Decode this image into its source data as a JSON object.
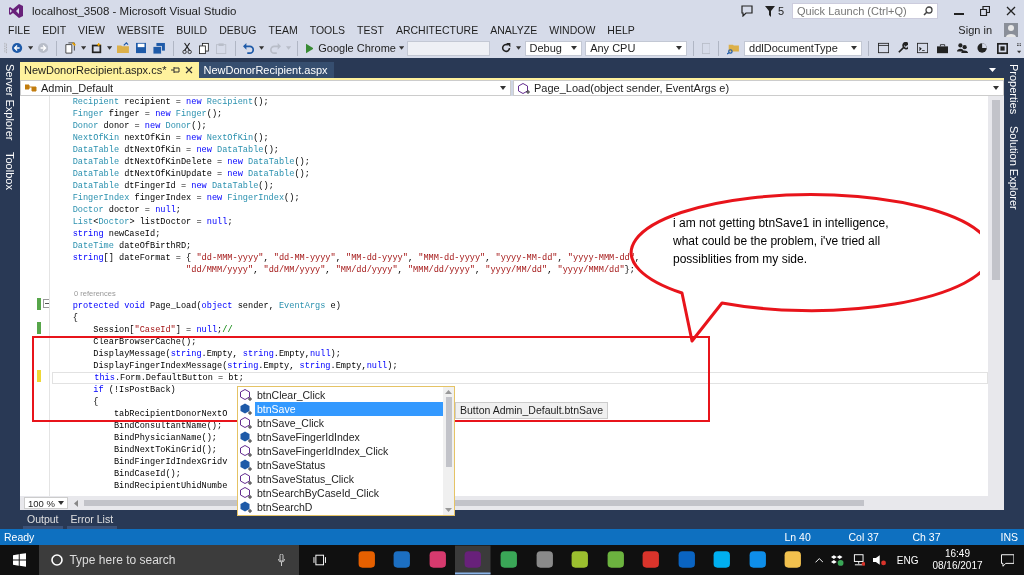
{
  "window": {
    "title": "localhost_3508 - Microsoft Visual Studio",
    "notification_count": "5",
    "quick_launch": {
      "placeholder": "Quick Launch (Ctrl+Q)"
    }
  },
  "menu": [
    "FILE",
    "EDIT",
    "VIEW",
    "WEBSITE",
    "BUILD",
    "DEBUG",
    "TEAM",
    "TOOLS",
    "TEST",
    "ARCHITECTURE",
    "ANALYZE",
    "WINDOW",
    "HELP"
  ],
  "account": {
    "label": "Sign in"
  },
  "toolbar": {
    "start_target": "Google Chrome",
    "configuration": "Debug",
    "platform": "Any CPU",
    "control": "ddlDocumentType"
  },
  "left_panels": [
    "Server Explorer",
    "Toolbox"
  ],
  "right_panels": [
    "Properties",
    "Solution Explorer"
  ],
  "tabs": [
    {
      "label": "NewDonorRecipient.aspx.cs*",
      "selected": true
    },
    {
      "label": "NewDonorRecipient.aspx",
      "selected": false
    }
  ],
  "navigation": {
    "type": "Admin_Default",
    "member": "Page_Load(object sender, EventArgs e)"
  },
  "code": {
    "lines": [
      {
        "kind": "code",
        "tokens": [
          {
            "text": "    Recipient",
            "kind": "type"
          },
          {
            "text": " recipient = ",
            "kind": "plain"
          },
          {
            "text": "new",
            "kind": "kw"
          },
          {
            "text": " Recipient",
            "kind": "type"
          },
          {
            "text": "();",
            "kind": "plain"
          }
        ]
      },
      {
        "kind": "code",
        "tokens": [
          {
            "text": "    Finger",
            "kind": "type"
          },
          {
            "text": " finger = ",
            "kind": "plain"
          },
          {
            "text": "new",
            "kind": "kw"
          },
          {
            "text": " Finger",
            "kind": "type"
          },
          {
            "text": "();",
            "kind": "plain"
          }
        ]
      },
      {
        "kind": "code",
        "tokens": [
          {
            "text": "    Donor",
            "kind": "type"
          },
          {
            "text": " donor = ",
            "kind": "plain"
          },
          {
            "text": "new",
            "kind": "kw"
          },
          {
            "text": " Donor",
            "kind": "type"
          },
          {
            "text": "();",
            "kind": "plain"
          }
        ]
      },
      {
        "kind": "code",
        "tokens": [
          {
            "text": "    NextOfKin",
            "kind": "type"
          },
          {
            "text": " nextOfKin = ",
            "kind": "plain"
          },
          {
            "text": "new",
            "kind": "kw"
          },
          {
            "text": " NextOfKin",
            "kind": "type"
          },
          {
            "text": "();",
            "kind": "plain"
          }
        ]
      },
      {
        "kind": "code",
        "tokens": [
          {
            "text": "    DataTable",
            "kind": "type"
          },
          {
            "text": " dtNextOfKin = ",
            "kind": "plain"
          },
          {
            "text": "new",
            "kind": "kw"
          },
          {
            "text": " DataTable",
            "kind": "type"
          },
          {
            "text": "();",
            "kind": "plain"
          }
        ]
      },
      {
        "kind": "code",
        "tokens": [
          {
            "text": "    DataTable",
            "kind": "type"
          },
          {
            "text": " dtNextOfKinDelete = ",
            "kind": "plain"
          },
          {
            "text": "new",
            "kind": "kw"
          },
          {
            "text": " DataTable",
            "kind": "type"
          },
          {
            "text": "();",
            "kind": "plain"
          }
        ]
      },
      {
        "kind": "code",
        "tokens": [
          {
            "text": "    DataTable",
            "kind": "type"
          },
          {
            "text": " dtNextOfKinUpdate = ",
            "kind": "plain"
          },
          {
            "text": "new",
            "kind": "kw"
          },
          {
            "text": " DataTable",
            "kind": "type"
          },
          {
            "text": "();",
            "kind": "plain"
          }
        ]
      },
      {
        "kind": "code",
        "tokens": [
          {
            "text": "    DataTable",
            "kind": "type"
          },
          {
            "text": " dtFingerId = ",
            "kind": "plain"
          },
          {
            "text": "new",
            "kind": "kw"
          },
          {
            "text": " DataTable",
            "kind": "type"
          },
          {
            "text": "();",
            "kind": "plain"
          }
        ]
      },
      {
        "kind": "code",
        "tokens": [
          {
            "text": "    FingerIndex",
            "kind": "type"
          },
          {
            "text": " fingerIndex = ",
            "kind": "plain"
          },
          {
            "text": "new",
            "kind": "kw"
          },
          {
            "text": " FingerIndex",
            "kind": "type"
          },
          {
            "text": "();",
            "kind": "plain"
          }
        ]
      },
      {
        "kind": "code",
        "tokens": [
          {
            "text": "    Doctor",
            "kind": "type"
          },
          {
            "text": " doctor = ",
            "kind": "plain"
          },
          {
            "text": "null",
            "kind": "kw"
          },
          {
            "text": ";",
            "kind": "plain"
          }
        ]
      },
      {
        "kind": "code",
        "tokens": [
          {
            "text": "    List",
            "kind": "type"
          },
          {
            "text": "<",
            "kind": "plain"
          },
          {
            "text": "Doctor",
            "kind": "type"
          },
          {
            "text": "> listDoctor = ",
            "kind": "plain"
          },
          {
            "text": "null",
            "kind": "kw"
          },
          {
            "text": ";",
            "kind": "plain"
          }
        ]
      },
      {
        "kind": "code",
        "tokens": [
          {
            "text": "    string",
            "kind": "kw"
          },
          {
            "text": " newCaseId;",
            "kind": "plain"
          }
        ]
      },
      {
        "kind": "code",
        "tokens": [
          {
            "text": "    DateTime",
            "kind": "type"
          },
          {
            "text": " dateOfBirthRD;",
            "kind": "plain"
          }
        ]
      },
      {
        "kind": "code",
        "tokens": [
          {
            "text": "    string",
            "kind": "kw"
          },
          {
            "text": "[] dateFormat = { ",
            "kind": "plain"
          },
          {
            "text": "\"dd-MMM-yyyy\"",
            "kind": "str"
          },
          {
            "text": ", ",
            "kind": "plain"
          },
          {
            "text": "\"dd-MM-yyyy\"",
            "kind": "str"
          },
          {
            "text": ", ",
            "kind": "plain"
          },
          {
            "text": "\"MM-dd-yyyy\"",
            "kind": "str"
          },
          {
            "text": ", ",
            "kind": "plain"
          },
          {
            "text": "\"MMM-dd-yyyy\"",
            "kind": "str"
          },
          {
            "text": ", ",
            "kind": "plain"
          },
          {
            "text": "\"yyyy-MM-dd\"",
            "kind": "str"
          },
          {
            "text": ", ",
            "kind": "plain"
          },
          {
            "text": "\"yyyy-MMM-dd\"",
            "kind": "str"
          },
          {
            "text": ",",
            "kind": "plain"
          }
        ]
      },
      {
        "kind": "code",
        "tokens": [
          {
            "text": "                          \"dd/MMM/yyyy\"",
            "kind": "str"
          },
          {
            "text": ", ",
            "kind": "plain"
          },
          {
            "text": "\"dd/MM/yyyy\"",
            "kind": "str"
          },
          {
            "text": ", ",
            "kind": "plain"
          },
          {
            "text": "\"MM/dd/yyyy\"",
            "kind": "str"
          },
          {
            "text": ", ",
            "kind": "plain"
          },
          {
            "text": "\"MMM/dd/yyyy\"",
            "kind": "str"
          },
          {
            "text": ", ",
            "kind": "plain"
          },
          {
            "text": "\"yyyy/MM/dd\"",
            "kind": "str"
          },
          {
            "text": ", ",
            "kind": "plain"
          },
          {
            "text": "\"yyyy/MMM/dd\"",
            "kind": "str"
          },
          {
            "text": "};",
            "kind": "plain"
          }
        ]
      },
      {
        "kind": "blank"
      },
      {
        "kind": "lens",
        "text": "0 references"
      },
      {
        "kind": "code",
        "modified": true,
        "saved": true,
        "fold": true,
        "tokens": [
          {
            "text": "    protected",
            "kind": "kw"
          },
          {
            "text": " void",
            "kind": "kw"
          },
          {
            "text": " Page_Load(",
            "kind": "plain"
          },
          {
            "text": "object",
            "kind": "kw"
          },
          {
            "text": " sender, ",
            "kind": "plain"
          },
          {
            "text": "EventArgs",
            "kind": "type"
          },
          {
            "text": " e)",
            "kind": "plain"
          }
        ]
      },
      {
        "kind": "code",
        "tokens": [
          {
            "text": "    {",
            "kind": "plain"
          }
        ]
      },
      {
        "kind": "code",
        "modified": true,
        "saved": true,
        "tokens": [
          {
            "text": "        Session[",
            "kind": "plain"
          },
          {
            "text": "\"CaseId\"",
            "kind": "str"
          },
          {
            "text": "] = ",
            "kind": "plain"
          },
          {
            "text": "null",
            "kind": "kw"
          },
          {
            "text": ";",
            "kind": "plain"
          },
          {
            "text": "//",
            "kind": "comment"
          }
        ]
      },
      {
        "kind": "code",
        "tokens": [
          {
            "text": "        ClearBrowserCache();",
            "kind": "plain"
          }
        ]
      },
      {
        "kind": "code",
        "tokens": [
          {
            "text": "        DisplayMessage(",
            "kind": "plain"
          },
          {
            "text": "string",
            "kind": "kw"
          },
          {
            "text": ".Empty, ",
            "kind": "plain"
          },
          {
            "text": "string",
            "kind": "kw"
          },
          {
            "text": ".Empty,",
            "kind": "plain"
          },
          {
            "text": "null",
            "kind": "kw"
          },
          {
            "text": ");",
            "kind": "plain"
          }
        ]
      },
      {
        "kind": "code",
        "tokens": [
          {
            "text": "        DisplayFingerIndexMessage(",
            "kind": "plain"
          },
          {
            "text": "string",
            "kind": "kw"
          },
          {
            "text": ".Empty, ",
            "kind": "plain"
          },
          {
            "text": "string",
            "kind": "kw"
          },
          {
            "text": ".Empty,",
            "kind": "plain"
          },
          {
            "text": "null",
            "kind": "kw"
          },
          {
            "text": ");",
            "kind": "plain"
          }
        ]
      },
      {
        "kind": "code",
        "modified": true,
        "saved": false,
        "current": true,
        "tokens": [
          {
            "text": "        this",
            "kind": "kw"
          },
          {
            "text": ".Form.DefaultButton = bt;",
            "kind": "plain"
          }
        ]
      },
      {
        "kind": "code",
        "tokens": [
          {
            "text": "        if",
            "kind": "kw"
          },
          {
            "text": " (!IsPostBack)",
            "kind": "plain"
          }
        ]
      },
      {
        "kind": "code",
        "tokens": [
          {
            "text": "        {",
            "kind": "plain"
          }
        ]
      },
      {
        "kind": "code",
        "tokens": [
          {
            "text": "            tabRecipientDonorNextO",
            "kind": "plain"
          }
        ]
      },
      {
        "kind": "code",
        "tokens": [
          {
            "text": "            BindConsultantName();",
            "kind": "plain"
          }
        ]
      },
      {
        "kind": "code",
        "tokens": [
          {
            "text": "            BindPhysicianName();",
            "kind": "plain"
          }
        ]
      },
      {
        "kind": "code",
        "tokens": [
          {
            "text": "            BindNextToKinGrid();",
            "kind": "plain"
          }
        ]
      },
      {
        "kind": "code",
        "tokens": [
          {
            "text": "            BindFingerIdIndexGridv",
            "kind": "plain"
          }
        ]
      },
      {
        "kind": "code",
        "tokens": [
          {
            "text": "            BindCaseId();",
            "kind": "plain"
          }
        ]
      },
      {
        "kind": "code",
        "tokens": [
          {
            "text": "            BindRecipientUhidNumbe",
            "kind": "plain"
          }
        ]
      }
    ]
  },
  "completion": {
    "items": [
      {
        "label": "btnClear_Click",
        "kind": "method",
        "selected": false
      },
      {
        "label": "btnSave",
        "kind": "field",
        "selected": true
      },
      {
        "label": "btnSave_Click",
        "kind": "method",
        "selected": false
      },
      {
        "label": "btnSaveFingerIdIndex",
        "kind": "field",
        "selected": false
      },
      {
        "label": "btnSaveFingerIdIndex_Click",
        "kind": "method",
        "selected": false
      },
      {
        "label": "btnSaveStatus",
        "kind": "field",
        "selected": false
      },
      {
        "label": "btnSaveStatus_Click",
        "kind": "method",
        "selected": false
      },
      {
        "label": "btnSearchByCaseId_Click",
        "kind": "method",
        "selected": false
      },
      {
        "label": "btnSearchD",
        "kind": "field",
        "selected": false
      }
    ],
    "tooltip": "Button Admin_Default.btnSave"
  },
  "annotation": {
    "text": "i am not getting btnSave1 in intelligence, what could be the problem, i've tried all possiblities from my side."
  },
  "zoom": "100 %",
  "bottom_tabs": [
    "Output",
    "Error List"
  ],
  "status_bar": {
    "message": "Ready",
    "line": "Ln 40",
    "column": "Col 37",
    "char": "Ch 37",
    "mode": "INS"
  },
  "taskbar": {
    "search": {
      "placeholder": "Type here to search"
    },
    "apps": [
      {
        "color": "#e66000",
        "selected": false
      },
      {
        "color": "#1c6fc2",
        "selected": false
      },
      {
        "color": "#d63a6e",
        "selected": false
      },
      {
        "color": "#68217a",
        "selected": true
      },
      {
        "color": "#3aa757",
        "selected": false
      },
      {
        "color": "#8a8a8a",
        "selected": false
      },
      {
        "color": "#9bbf2f",
        "selected": false
      },
      {
        "color": "#6cb33f",
        "selected": false
      },
      {
        "color": "#d9342b",
        "selected": false
      },
      {
        "color": "#0a64c2",
        "selected": false
      },
      {
        "color": "#00aff0",
        "selected": false
      },
      {
        "color": "#0e8ee9",
        "selected": false
      },
      {
        "color": "#f2c14e",
        "selected": false
      }
    ],
    "language": "ENG",
    "time": "16:49",
    "date": "08/16/2017"
  }
}
